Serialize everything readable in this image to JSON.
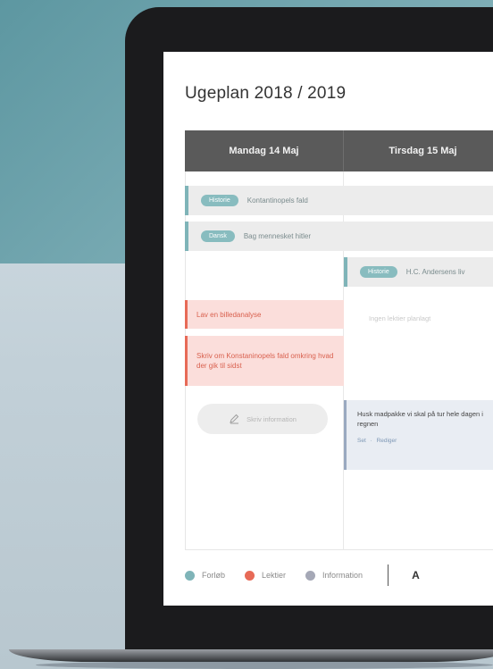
{
  "plan": {
    "title": "Ugeplan 2018 / 2019",
    "days": [
      "Mandag 14 Maj",
      "Tirsdag 15 Maj"
    ],
    "courses": [
      {
        "tag": "Historie",
        "text": "Kontantinopels fald"
      },
      {
        "tag": "Dansk",
        "text": "Bag mennesket hitler"
      },
      {
        "tag": "Historie",
        "text": "H.C. Andersens liv"
      }
    ],
    "lessons": [
      {
        "text": "Lav en billedanalyse"
      },
      {
        "text": "Skriv om Konstaninopels fald omkring hvad der gik til sidst"
      }
    ],
    "empty_text": "Ingen lektier planlagt",
    "write_button": "Skriv information",
    "info_card": {
      "text": "Husk madpakke vi skal på tur hele dagen i regnen",
      "action_seen": "Set",
      "action_separator": "·",
      "action_edit": "Rediger"
    },
    "legend": [
      {
        "label": "Forløb",
        "color": "#7fb4b8"
      },
      {
        "label": "Lektier",
        "color": "#e76a57"
      },
      {
        "label": "Information",
        "color": "#a5a8b6"
      }
    ],
    "legend_cut": "A"
  },
  "colors": {
    "header_bg": "#5a5a5a",
    "course_accent": "#7fb4b8",
    "lesson_accent": "#e76a57",
    "info_accent": "#9aa9c0"
  }
}
